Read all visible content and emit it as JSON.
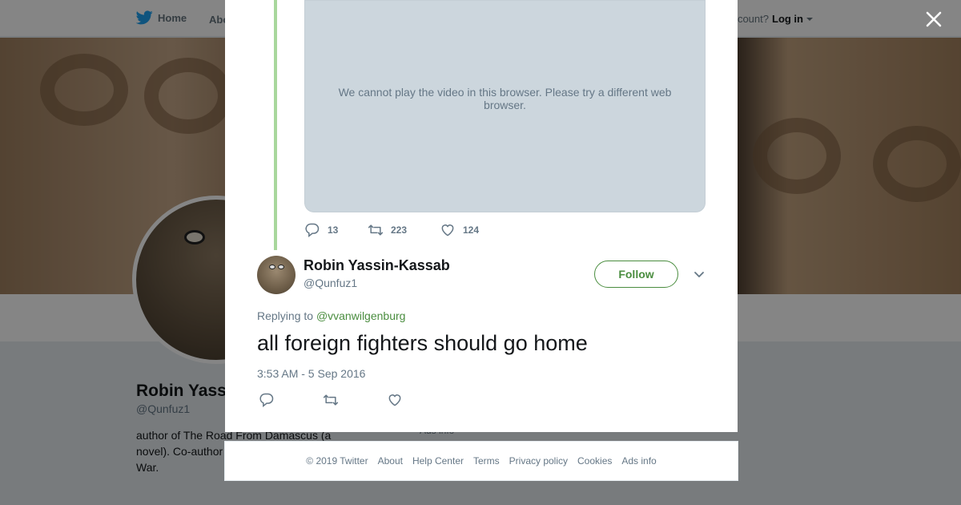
{
  "nav": {
    "home_label": "Home",
    "about_label": "Abo",
    "account_prompt": "ccount?",
    "login_label": "Log in"
  },
  "profile": {
    "name": "Robin Yass",
    "handle": "@Qunfuz1",
    "bio": "author of The Road From Damascus (a novel). Co-author Burning Country: and War.",
    "ads_ghost": "Ads info"
  },
  "modal": {
    "video_message": "We cannot play the video in this browser. Please try a different web browser.",
    "prev_tweet_actions": {
      "replies": "13",
      "retweets": "223",
      "likes": "124"
    },
    "tweet": {
      "author_name": "Robin Yassin-Kassab",
      "author_handle": "@Qunfuz1",
      "follow_label": "Follow",
      "replying_prefix": "Replying to",
      "replying_to": "@vvanwilgenburg",
      "text": "all foreign fighters should go home",
      "timestamp": "3:53 AM - 5 Sep 2016"
    }
  },
  "footer": {
    "copyright": "© 2019 Twitter",
    "links": [
      "About",
      "Help Center",
      "Terms",
      "Privacy policy",
      "Cookies",
      "Ads info"
    ]
  },
  "colors": {
    "twitter_blue": "#1da1f2",
    "accent_green": "#4a8d3f",
    "thread_line": "#a8d79c",
    "muted_text": "#657786"
  },
  "icons": {
    "nav_logo": "twitter-bird-icon",
    "close": "close-icon",
    "reply": "reply-icon",
    "retweet": "retweet-icon",
    "like": "heart-icon",
    "more": "chevron-down-icon",
    "login_caret": "caret-down-icon"
  }
}
